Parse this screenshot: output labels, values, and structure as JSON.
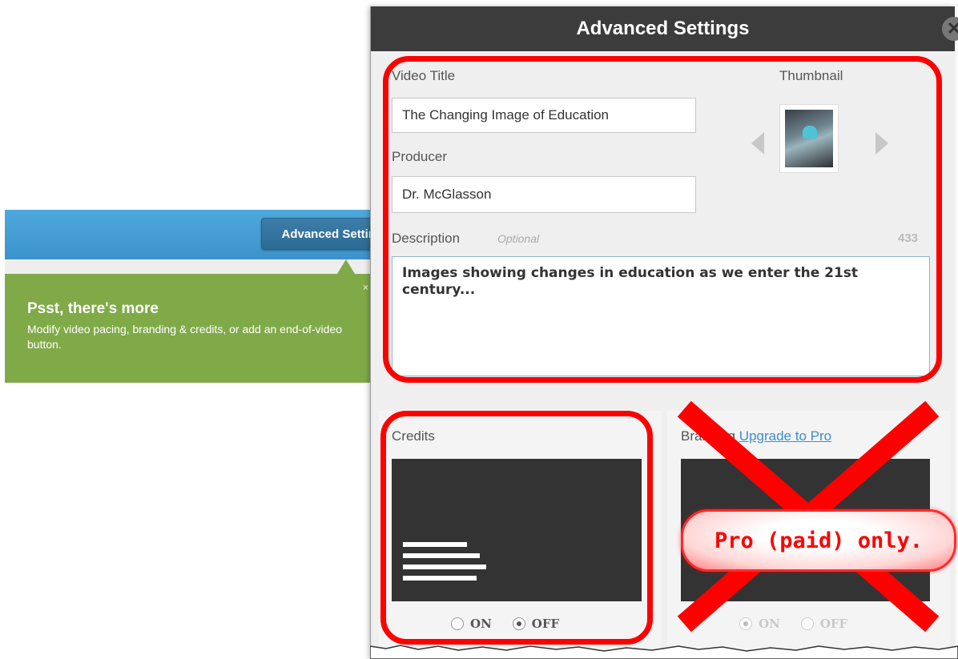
{
  "tooltip_bar": {
    "button_label": "Advanced Settings"
  },
  "tooltip": {
    "title": "Psst, there's more",
    "body": "Modify video pacing, branding & credits, or add an end-of-video button.",
    "close": "×"
  },
  "dialog": {
    "title": "Advanced Settings",
    "close_icon": "close-icon",
    "video_title_label": "Video Title",
    "video_title_value": "The Changing Image of Education",
    "producer_label": "Producer",
    "producer_value": "Dr. McGlasson",
    "thumbnail_label": "Thumbnail",
    "description_label": "Description",
    "description_optional": "Optional",
    "description_count": "433",
    "description_value": "Images showing changes in education as we enter the 21st century...",
    "credits": {
      "label": "Credits",
      "on": "ON",
      "off": "OFF",
      "selected": "OFF"
    },
    "branding": {
      "label": "Branding",
      "upgrade_link": "Upgrade to Pro",
      "on": "ON",
      "off": "OFF",
      "selected": "ON"
    }
  },
  "annotation": {
    "pro_only": "Pro (paid) only."
  },
  "colors": {
    "annotation_red": "#ff0000",
    "tooltip_green": "#80aa48",
    "header_dark": "#3c3c3c"
  }
}
